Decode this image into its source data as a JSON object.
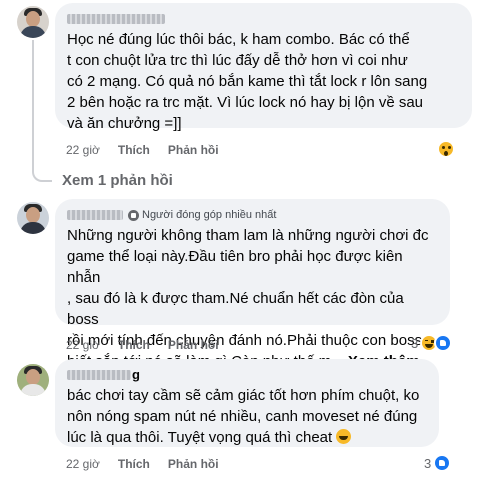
{
  "comments": [
    {
      "author_tail": "",
      "badge": "",
      "text": "Học né đúng lúc thôi bác, k ham combo. Bác có thể\n   t con chuột lửa trc thì lúc đấy dễ thở hơn vì coi như\ncó 2 mạng. Có quả nó bắn kame thì tắt lock r lôn sang\n2 bên hoặc ra trc mặt. Vì lúc lock nó hay bị lộn về sau\nvà ăn chưởng =]]",
      "see_more": "",
      "time": "22 giờ",
      "like_label": "Thích",
      "reply_label": "Phản hồi",
      "reaction_count": "",
      "reactions": [
        "wow"
      ]
    },
    {
      "author_tail": "",
      "badge": "Người đóng góp nhiều nhất",
      "text": "Những người không tham lam là những người chơi đc\ngame thể loại này.Đầu tiên bro phải học được kiên nhẫn\n, sau đó là k được tham.Né chuẩn hết các đòn của boss\nrồi mới tính đến chuyện đánh nó.Phải thuộc con boss ,\nbiết sắp tới nó sẽ làm gì.Còn như thế m...",
      "see_more": "Xem thêm",
      "time": "22 giờ",
      "like_label": "Thích",
      "reply_label": "Phản hồi",
      "reaction_count": "3",
      "reactions": [
        "haha",
        "like"
      ]
    },
    {
      "author_tail": "g",
      "badge": "",
      "text": "bác chơi tay cầm sẽ cảm giác tốt hơn phím chuột, ko\nnôn nóng spam nút né nhiều, canh moveset né đúng\nlúc là qua thôi. Tuyệt vọng quá thì cheat",
      "see_more": "",
      "time": "22 giờ",
      "like_label": "Thích",
      "reply_label": "Phản hồi",
      "reaction_count": "3",
      "reactions": [
        "like"
      ]
    }
  ],
  "view_replies": "Xem 1 phản hồi",
  "colors": {
    "bubble": "#f0f2f5",
    "meta": "#65676b",
    "like_blue": "#1877f2",
    "reaction_yellow": "#f7b928"
  }
}
